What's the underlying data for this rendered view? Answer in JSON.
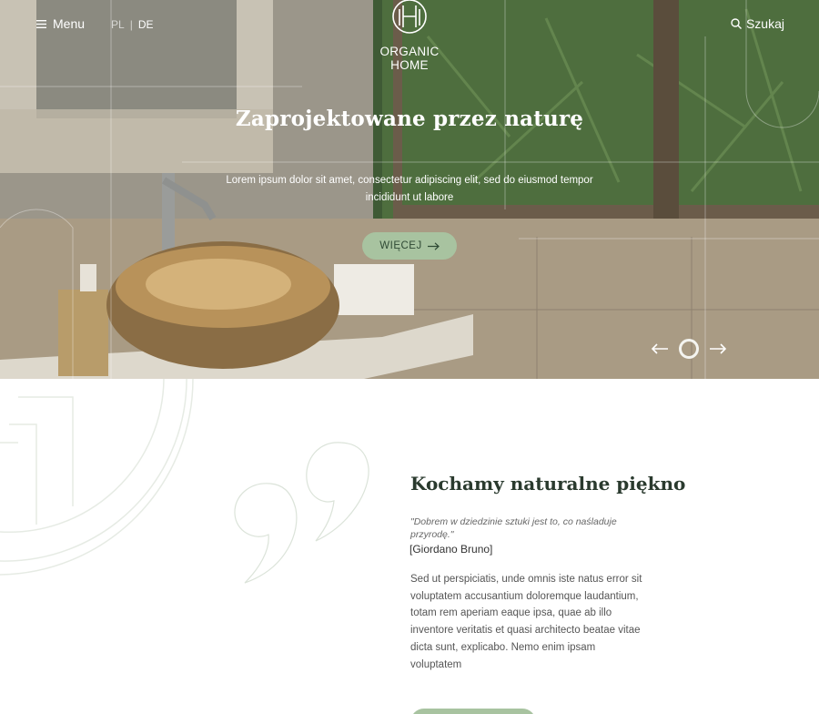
{
  "header": {
    "menu_label": "Menu",
    "languages": [
      "PL",
      "DE"
    ],
    "separator": "|",
    "logo_line1": "ORGANIC",
    "logo_line2": "HOME",
    "search_label": "Szukaj"
  },
  "hero": {
    "title": "Zaprojektowane przez naturę",
    "text": "Lorem ipsum dolor sit amet, consectetur adipiscing elit, sed do eiusmod tempor incididunt ut labore",
    "button_label": "WIĘCEJ",
    "slider_dots": 1
  },
  "section": {
    "title": "Kochamy naturalne piękno",
    "quote": "\"Dobrem w dziedzinie sztuki jest to, co naśladuje przyrodę.\"",
    "author": "[Giordano Bruno]",
    "body": "Sed ut perspiciatis, unde omnis iste natus error sit voluptatem accusantium doloremque laudantium, totam rem aperiam eaque ipsa, quae ab illo inventore veritatis et quasi architecto beatae vitae dicta sunt, explicabo. Nemo enim ipsam voluptatem"
  },
  "colors": {
    "accent_green": "#a8c3a0",
    "dark_green_text": "#2a3a2e"
  },
  "icons": [
    "hamburger-icon",
    "logo-monogram-icon",
    "search-icon",
    "arrow-right-icon",
    "arrow-left-icon",
    "quote-icon"
  ]
}
